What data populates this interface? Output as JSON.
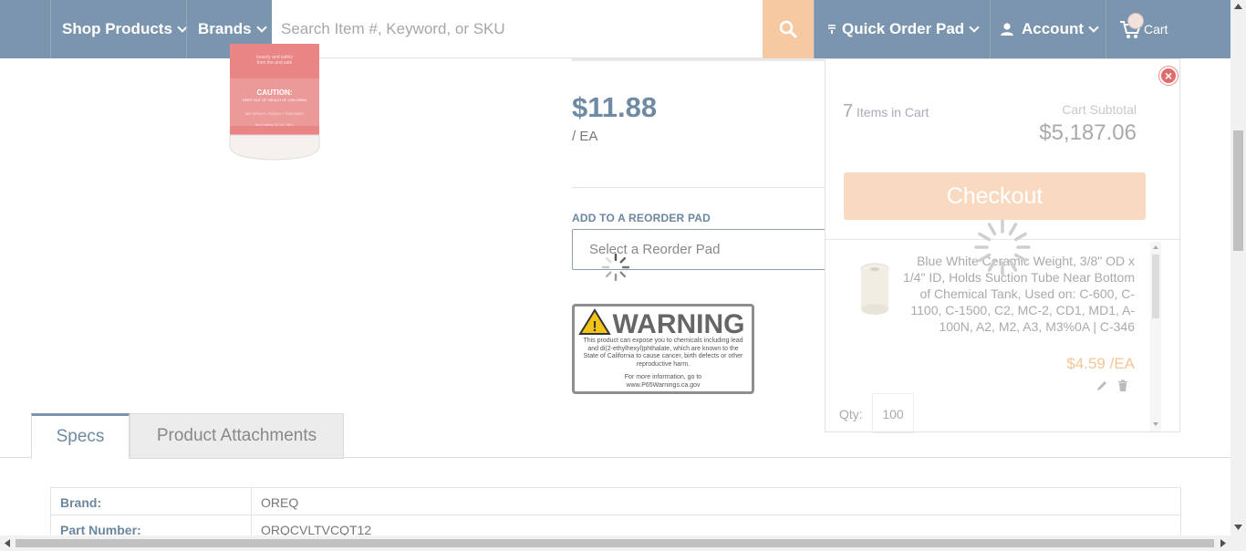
{
  "nav": {
    "shop_products": "Shop Products",
    "brands": "Brands",
    "search_placeholder": "Search Item #, Keyword, or SKU",
    "quick_order_pad": "Quick Order Pad",
    "account": "Account",
    "cart": "Cart"
  },
  "product": {
    "price": "$11.88",
    "unit": "/ EA",
    "reorder_label": "ADD TO A REORDER PAD",
    "reorder_placeholder": "Select a Reorder Pad",
    "label_caution": "CAUTION:",
    "label_caution_sub": "KEEP OUT OF REACH OF CHILDREN"
  },
  "warning_label": {
    "title": "WARNING",
    "body": "This product can expose you to chemicals including lead and di(2-ethylhexyl)phthalate, which are known to the State of California to cause cancer, birth defects or other reproductive harm.",
    "more": "For more information, go to www.P65Warnings.ca.gov"
  },
  "tabs": [
    {
      "label": "Specs",
      "active": true
    },
    {
      "label": "Product Attachments",
      "active": false
    }
  ],
  "specs": [
    {
      "key": "Brand:",
      "value": "OREQ"
    },
    {
      "key": "Part Number:",
      "value": "ORQCVLTVCQT12"
    }
  ],
  "cart_panel": {
    "items_count": "7",
    "items_label": "Items in Cart",
    "subtotal_label": "Cart Subtotal",
    "subtotal": "$5,187.06",
    "checkout_label": "Checkout",
    "item": {
      "title": "Blue White Ceramic Weight, 3/8\" OD x 1/4\" ID, Holds Suction Tube Near Bottom of Chemical Tank, Used on: C-600, C-1100, C-1500, C2, MC-2, CD1, MD1, A-100N, A2, M2, A3, M3%0A | C-346",
      "price": "$4.59 /EA",
      "qty_label": "Qty:",
      "qty": "100"
    }
  },
  "colors": {
    "nav_bg": "#7a95ad",
    "accent_orange": "#f7c9a2",
    "price_blue": "#6f8aa3",
    "close_red": "#e06b6b"
  }
}
